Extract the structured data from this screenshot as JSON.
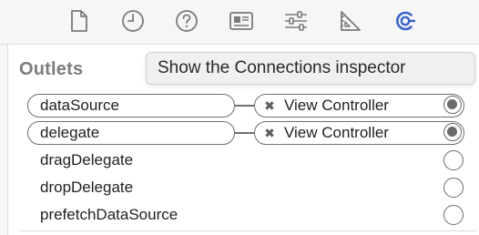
{
  "toolbar": {
    "icons": [
      {
        "name": "file-inspector-icon"
      },
      {
        "name": "history-inspector-icon"
      },
      {
        "name": "quick-help-icon"
      },
      {
        "name": "identity-inspector-icon"
      },
      {
        "name": "attributes-inspector-icon"
      },
      {
        "name": "size-inspector-icon"
      },
      {
        "name": "connections-inspector-icon",
        "active": true
      }
    ],
    "active_color": "#3b63c9",
    "icon_color": "#7a7a7a"
  },
  "section": {
    "title": "Outlets"
  },
  "tooltip": {
    "text": "Show the Connections inspector"
  },
  "outlets": [
    {
      "name": "dataSource",
      "connected": true,
      "target": "View Controller"
    },
    {
      "name": "delegate",
      "connected": true,
      "target": "View Controller"
    },
    {
      "name": "dragDelegate",
      "connected": false
    },
    {
      "name": "dropDelegate",
      "connected": false
    },
    {
      "name": "prefetchDataSource",
      "connected": false
    }
  ]
}
